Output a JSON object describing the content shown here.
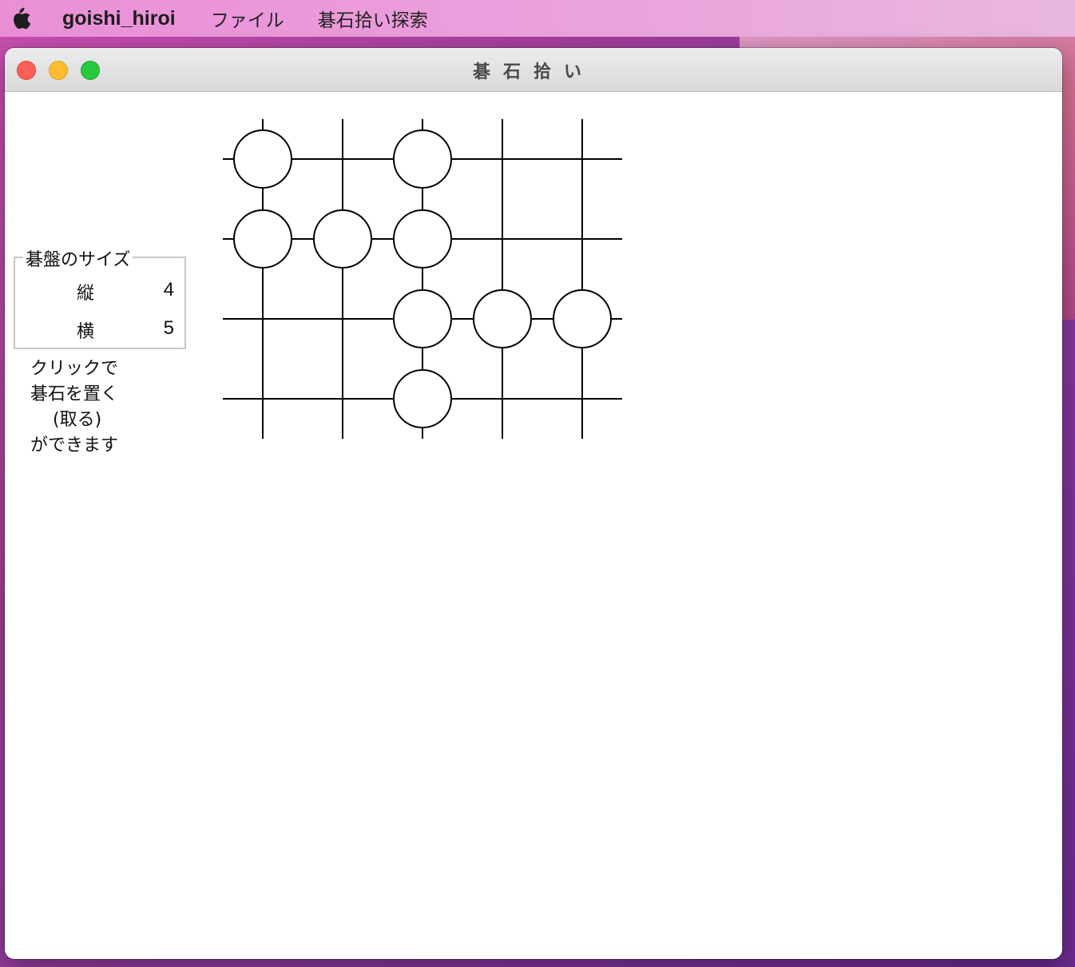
{
  "menubar": {
    "app_name": "goishi_hiroi",
    "items": [
      "ファイル",
      "碁石拾い探索"
    ]
  },
  "window": {
    "title": "碁石拾い"
  },
  "board_size": {
    "legend": "碁盤のサイズ",
    "rows_label": "縦",
    "rows_value": "4",
    "cols_label": "横",
    "cols_value": "5"
  },
  "instructions": {
    "line1": "クリックで",
    "line2": "碁石を置く",
    "line3": "(取る)",
    "line4": "ができます"
  },
  "board": {
    "rows": 4,
    "cols": 5,
    "stones": [
      [
        1,
        0,
        1,
        0,
        0
      ],
      [
        1,
        1,
        1,
        0,
        0
      ],
      [
        0,
        0,
        1,
        1,
        1
      ],
      [
        0,
        0,
        1,
        0,
        0
      ]
    ]
  }
}
